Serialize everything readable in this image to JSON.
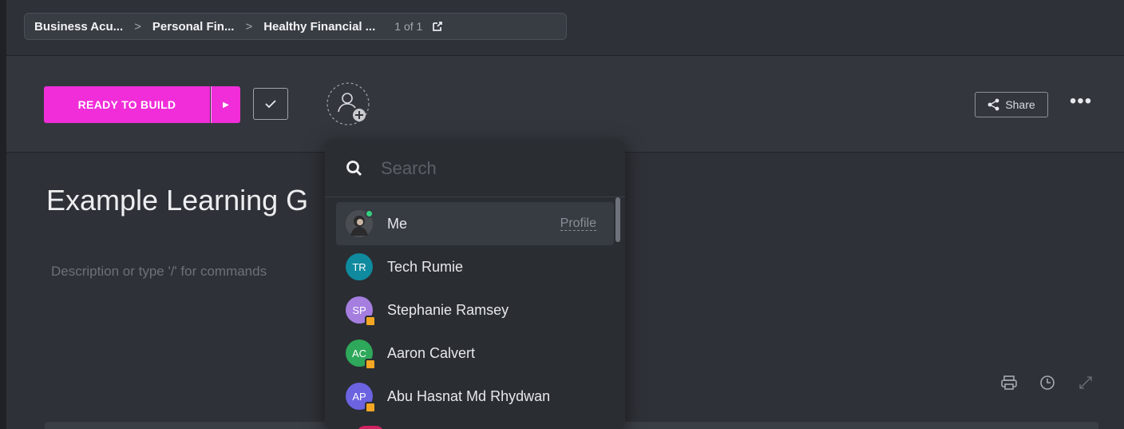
{
  "breadcrumb": {
    "items": [
      "Business Acu...",
      "Personal Fin...",
      "Healthy Financial ..."
    ],
    "separator": ">",
    "count": "1 of 1"
  },
  "task": {
    "status": "READY TO BUILD",
    "status_color": "#f02dd8",
    "title": "Example Learning G",
    "description_placeholder": "Description or type '/' for commands"
  },
  "header": {
    "share_label": "Share",
    "more_label": "•••"
  },
  "assignee_dropdown": {
    "search_placeholder": "Search",
    "members": [
      {
        "name": "Me",
        "initials": "",
        "color": "#5c5f66",
        "action": "Profile",
        "online": true,
        "badge": false
      },
      {
        "name": "Tech Rumie",
        "initials": "TR",
        "color": "#0f8a9e",
        "badge": false
      },
      {
        "name": "Stephanie Ramsey",
        "initials": "SP",
        "color": "#a57ee0",
        "badge": true
      },
      {
        "name": "Aaron Calvert",
        "initials": "AC",
        "color": "#2ea85a",
        "badge": true
      },
      {
        "name": "Abu Hasnat Md Rhydwan",
        "initials": "AP",
        "color": "#6b63e0",
        "badge": true
      }
    ]
  }
}
